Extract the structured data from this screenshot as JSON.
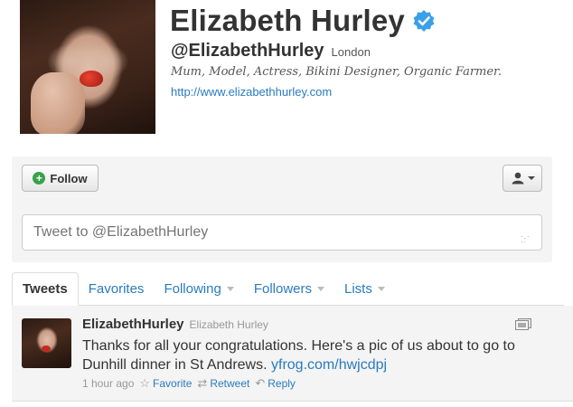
{
  "profile": {
    "name": "Elizabeth Hurley",
    "handle": "@ElizabethHurley",
    "location": "London",
    "bio": "Mum, Model, Actress, Bikini Designer, Organic Farmer.",
    "url": "http://www.elizabethhurley.com",
    "verified": true
  },
  "actions": {
    "follow_label": "Follow",
    "tweet_to_placeholder": "Tweet to @ElizabethHurley"
  },
  "tabs": [
    {
      "label": "Tweets",
      "active": true,
      "has_menu": false
    },
    {
      "label": "Favorites",
      "active": false,
      "has_menu": false
    },
    {
      "label": "Following",
      "active": false,
      "has_menu": true
    },
    {
      "label": "Followers",
      "active": false,
      "has_menu": true
    },
    {
      "label": "Lists",
      "active": false,
      "has_menu": true
    }
  ],
  "tweet": {
    "screen_name": "ElizabethHurley",
    "full_name": "Elizabeth Hurley",
    "text": "Thanks for all your congratulations. Here's a pic of us about to go to Dunhill dinner in St Andrews. ",
    "link": "yfrog.com/hwjcdpj",
    "time": "1 hour ago",
    "favorite_label": "Favorite",
    "retweet_label": "Retweet",
    "reply_label": "Reply"
  },
  "colors": {
    "link": "#2a7bbf",
    "verified": "#3aa0e8",
    "follow_icon": "#3aa14a",
    "panel_bg": "#f4f4f4"
  },
  "icons": [
    "verified-badge-icon",
    "plus-icon",
    "user-icon",
    "chevron-down-icon",
    "media-icon",
    "star-icon",
    "retweet-icon",
    "reply-icon"
  ]
}
